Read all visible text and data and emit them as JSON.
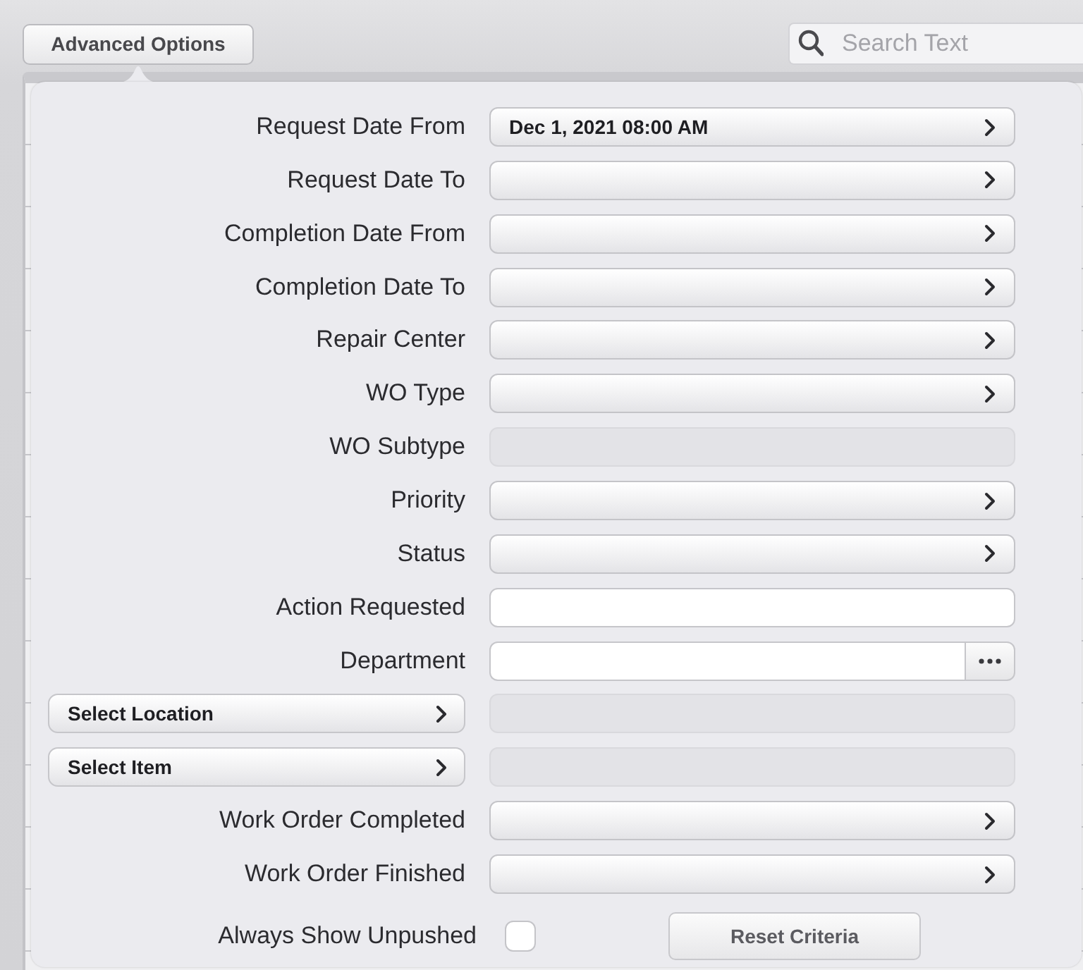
{
  "toolbar": {
    "advanced_button": {
      "label": "Advanced Options"
    },
    "search": {
      "placeholder": "Search Text"
    }
  },
  "criteria": [
    {
      "label": {
        "kind": "label",
        "text": "Request Date From"
      },
      "field": {
        "kind": "picker",
        "disabled": false,
        "value": "Dec 1, 2021 08:00 AM"
      }
    },
    {
      "label": {
        "kind": "label",
        "text": "Request Date To"
      },
      "field": {
        "kind": "picker",
        "disabled": false
      }
    },
    {
      "label": {
        "kind": "label",
        "text": "Completion Date From"
      },
      "field": {
        "kind": "picker",
        "disabled": false
      }
    },
    {
      "label": {
        "kind": "label",
        "text": "Completion Date To"
      },
      "field": {
        "kind": "picker",
        "disabled": false
      }
    },
    {
      "label": {
        "kind": "label",
        "text": "Repair Center"
      },
      "field": {
        "kind": "picker",
        "disabled": false
      }
    },
    {
      "label": {
        "kind": "label",
        "text": "WO Type"
      },
      "field": {
        "kind": "picker",
        "disabled": false
      }
    },
    {
      "label": {
        "kind": "label",
        "text": "WO Subtype"
      },
      "field": {
        "kind": "picker",
        "disabled": true
      }
    },
    {
      "label": {
        "kind": "label",
        "text": "Priority"
      },
      "field": {
        "kind": "picker",
        "disabled": false
      }
    },
    {
      "label": {
        "kind": "label",
        "text": "Status"
      },
      "field": {
        "kind": "picker",
        "disabled": false
      }
    },
    {
      "label": {
        "kind": "label",
        "text": "Action Requested"
      },
      "field": {
        "kind": "text",
        "disabled": false
      }
    },
    {
      "label": {
        "kind": "label",
        "text": "Department"
      },
      "field": {
        "kind": "lookup",
        "disabled": false
      }
    },
    {
      "label": {
        "kind": "button",
        "text": "Select Location"
      },
      "field": {
        "kind": "text",
        "disabled": true
      }
    },
    {
      "label": {
        "kind": "button",
        "text": "Select Item"
      },
      "field": {
        "kind": "text",
        "disabled": true
      }
    },
    {
      "label": {
        "kind": "label",
        "text": "Work Order Completed"
      },
      "field": {
        "kind": "picker",
        "disabled": false
      }
    },
    {
      "label": {
        "kind": "label",
        "text": "Work Order Finished"
      },
      "field": {
        "kind": "picker",
        "disabled": false
      }
    }
  ],
  "always_show_unpushed": {
    "label": "Always Show Unpushed",
    "checked": false
  },
  "reset_button": {
    "label": "Reset Criteria"
  }
}
